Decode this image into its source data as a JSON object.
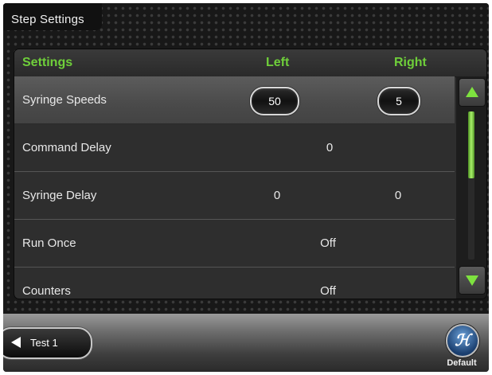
{
  "title": "Step Settings",
  "header": {
    "settings": "Settings",
    "left": "Left",
    "right": "Right"
  },
  "rows": [
    {
      "label": "Syringe Speeds",
      "left": "50",
      "right": "5"
    },
    {
      "label": "Command Delay",
      "value": "0"
    },
    {
      "label": "Syringe Delay",
      "left": "0",
      "right": "0"
    },
    {
      "label": "Run Once",
      "value": "Off"
    },
    {
      "label": "Counters",
      "value": "Off"
    }
  ],
  "icons": {
    "scroll_up": "triangle-up-icon",
    "scroll_down": "triangle-down-icon",
    "back": "triangle-left-icon",
    "default": "h-logo-icon"
  },
  "footer": {
    "back_label": "Test 1",
    "default_label": "Default"
  },
  "colors": {
    "accent": "#7ee23f",
    "header_text": "#6fcf3a"
  }
}
